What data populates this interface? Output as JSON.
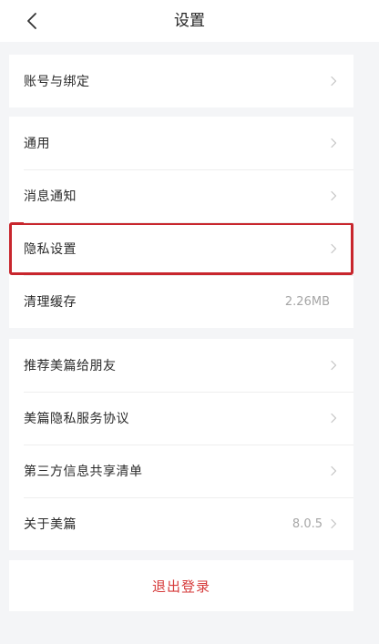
{
  "header": {
    "title": "设置"
  },
  "groups": [
    {
      "items": [
        {
          "label": "账号与绑定"
        }
      ]
    },
    {
      "items": [
        {
          "label": "通用"
        },
        {
          "label": "消息通知"
        },
        {
          "label": "隐私设置",
          "highlighted": true
        },
        {
          "label": "清理缓存",
          "value": "2.26MB"
        }
      ]
    },
    {
      "items": [
        {
          "label": "推荐美篇给朋友"
        },
        {
          "label": "美篇隐私服务协议"
        },
        {
          "label": "第三方信息共享清单"
        },
        {
          "label": "关于美篇",
          "value": "8.0.5"
        }
      ]
    }
  ],
  "logout": {
    "label": "退出登录"
  },
  "colors": {
    "highlight_border": "#c8262d",
    "logout_text": "#d63b3b",
    "background": "#f4f5f7"
  },
  "icons": {
    "back": "chevron-left-icon",
    "row_arrow": "chevron-right-icon"
  }
}
